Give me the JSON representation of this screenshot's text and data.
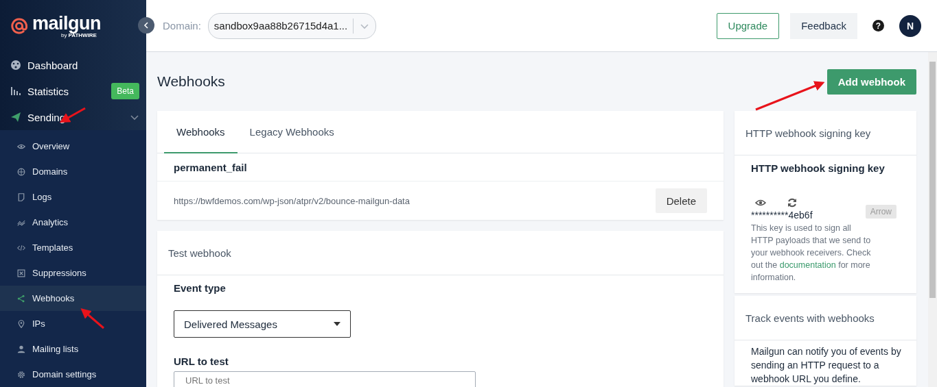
{
  "sidebar": {
    "logo": {
      "name": "mailgun",
      "by": "by",
      "brand": "PATHWIRE"
    },
    "items": [
      {
        "label": "Dashboard",
        "selected": false
      },
      {
        "label": "Statistics",
        "badge": "Beta",
        "selected": false
      },
      {
        "label": "Sending",
        "selected": false,
        "expanded": true,
        "children": [
          {
            "label": "Overview",
            "selected": false
          },
          {
            "label": "Domains",
            "selected": false
          },
          {
            "label": "Logs",
            "selected": false
          },
          {
            "label": "Analytics",
            "selected": false
          },
          {
            "label": "Templates",
            "selected": false
          },
          {
            "label": "Suppressions",
            "selected": false
          },
          {
            "label": "Webhooks",
            "selected": true
          },
          {
            "label": "IPs",
            "selected": false
          },
          {
            "label": "Mailing lists",
            "selected": false
          },
          {
            "label": "Domain settings",
            "selected": false
          }
        ]
      }
    ]
  },
  "header": {
    "domain_label": "Domain:",
    "domain": "sandbox9aa88b26715d4a1...",
    "upgrade": "Upgrade",
    "feedback": "Feedback",
    "help": "?",
    "avatar": "N"
  },
  "page": {
    "title": "Webhooks",
    "add_button": "Add webhook"
  },
  "tabs": [
    {
      "label": "Webhooks",
      "selected": true
    },
    {
      "label": "Legacy Webhooks",
      "selected": false
    }
  ],
  "webhooks": [
    {
      "event": "permanent_fail",
      "url": "https://bwfdemos.com/wp-json/atpr/v2/bounce-mailgun-data",
      "action": "Delete"
    }
  ],
  "test": {
    "title": "Test webhook",
    "event_label": "Event type",
    "event_value": "Delivered Messages",
    "url_label": "URL to test",
    "url_placeholder": "URL to test"
  },
  "signing": {
    "header": "HTTP webhook signing key",
    "title": "HTTP webhook signing key",
    "key": "**********4eb6f",
    "arrow_button": "Arrow",
    "arrow_disabled": true,
    "text_before": "This key is used to sign all HTTP payloads that we send to your webhook receivers. Check out the ",
    "link": "documentation",
    "text_after": " for more information."
  },
  "track": {
    "header": "Track events with webhooks",
    "text": "Mailgun can notify you of events by sending an HTTP request to a webhook URL you define."
  }
}
